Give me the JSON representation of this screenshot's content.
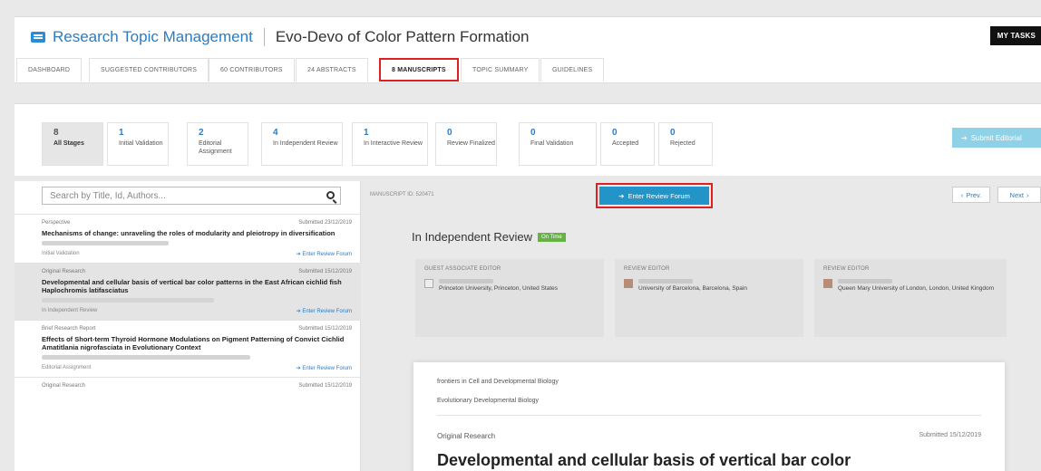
{
  "header": {
    "app_name": "Research Topic Management",
    "topic_title": "Evo-Devo of Color Pattern Formation",
    "my_tasks_label": "MY TASKS"
  },
  "tabs": [
    {
      "label": "DASHBOARD"
    },
    {
      "label": "SUGGESTED CONTRIBUTORS"
    },
    {
      "label": "60 CONTRIBUTORS"
    },
    {
      "label": "24 ABSTRACTS"
    },
    {
      "label": "8 MANUSCRIPTS"
    },
    {
      "label": "TOPIC SUMMARY"
    },
    {
      "label": "GUIDELINES"
    }
  ],
  "stages": [
    {
      "count": "8",
      "label": "All Stages"
    },
    {
      "count": "1",
      "label": "Initial Validation"
    },
    {
      "count": "2",
      "label": "Editorial Assignment"
    },
    {
      "count": "4",
      "label": "In Independent Review"
    },
    {
      "count": "1",
      "label": "In Interactive Review"
    },
    {
      "count": "0",
      "label": "Review Finalized"
    },
    {
      "count": "0",
      "label": "Final Validation"
    },
    {
      "count": "0",
      "label": "Accepted"
    },
    {
      "count": "0",
      "label": "Rejected"
    }
  ],
  "submit_editorial_label": "Submit Editorial",
  "search": {
    "placeholder": "Search by Title, Id, Authors..."
  },
  "manuscripts": [
    {
      "type": "Perspective",
      "submitted": "Submitted 23/12/2019",
      "title": "Mechanisms of change: unraveling the roles of modularity and pleiotropy in diversification",
      "stage": "Initial Validation",
      "link": "Enter Review Forum"
    },
    {
      "type": "Original Research",
      "submitted": "Submitted 15/12/2019",
      "title": "Developmental and cellular basis of vertical bar color patterns in the East African cichlid fish Haplochromis latifasciatus",
      "stage": "In Independent Review",
      "link": "Enter Review Forum"
    },
    {
      "type": "Brief Research Report",
      "submitted": "Submitted 15/12/2019",
      "title": "Effects of Short-term Thyroid Hormone Modulations on Pigment Patterning of Convict Cichlid Amatitlania nigrofasciata in Evolutionary Context",
      "stage": "Editorial Assignment",
      "link": "Enter Review Forum"
    },
    {
      "type": "Original Research",
      "submitted": "Submitted 15/12/2019"
    }
  ],
  "detail": {
    "manuscript_id": "MANUSCRIPT ID: 520471",
    "enter_forum_label": "Enter Review Forum",
    "prev_label": "Prev.",
    "next_label": "Next",
    "status": "In Independent Review",
    "status_badge": "On Time",
    "editors": [
      {
        "role": "GUEST ASSOCIATE EDITOR",
        "institution": "Princeton University, Princeton, United States"
      },
      {
        "role": "REVIEW EDITOR",
        "institution": "University of Barcelona, Barcelona, Spain"
      },
      {
        "role": "REVIEW EDITOR",
        "institution": "Queen Mary University of London, London, United Kingdom"
      }
    ],
    "paper": {
      "journal": "frontiers in Cell and Developmental Biology",
      "section": "Evolutionary Developmental Biology",
      "type": "Original Research",
      "submitted": "Submitted 15/12/2019",
      "title": "Developmental and cellular basis of vertical bar color"
    }
  }
}
